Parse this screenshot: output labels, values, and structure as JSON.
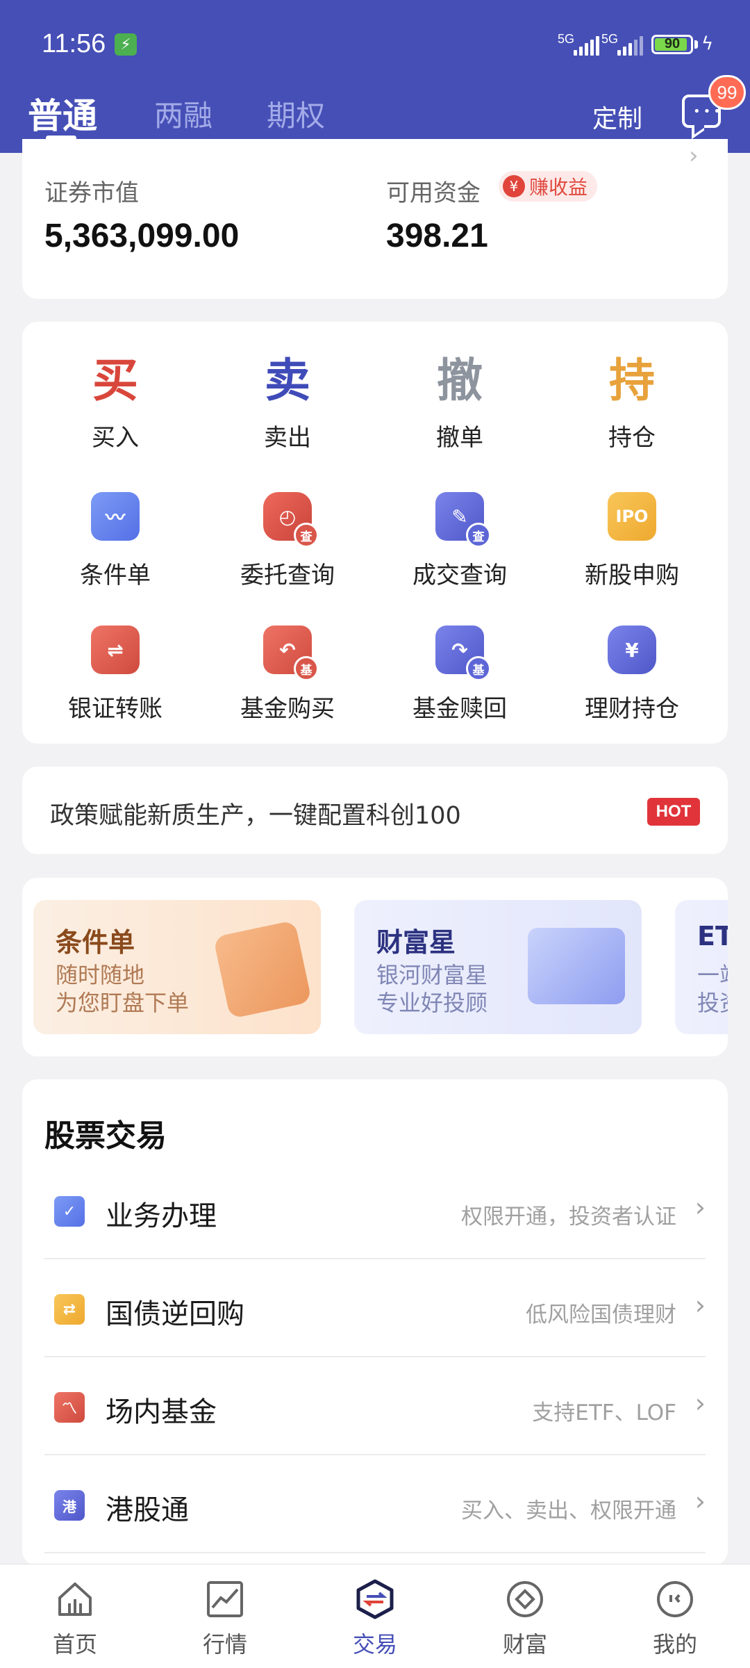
{
  "status_bar": {
    "time": "11:56",
    "network1": "5G",
    "network2": "5G",
    "battery": "90"
  },
  "header": {
    "tabs": [
      {
        "label": "普通",
        "active": true
      },
      {
        "label": "两融",
        "active": false
      },
      {
        "label": "期权",
        "active": false
      }
    ],
    "custom_label": "定制",
    "message_badge": "99"
  },
  "assets": {
    "securities_label": "证券市值",
    "securities_value": "5,363,099.00",
    "available_label": "可用资金",
    "available_value": "398.21",
    "earn_tag": "赚收益",
    "earn_icon": "¥"
  },
  "quick_actions": {
    "primary": [
      {
        "char": "买",
        "label": "买入",
        "color": "#d9463b"
      },
      {
        "char": "卖",
        "label": "卖出",
        "color": "#3f4bb8"
      },
      {
        "char": "撤",
        "label": "撤单",
        "color": "#8e949e"
      },
      {
        "char": "持",
        "label": "持仓",
        "color": "#e8a23c"
      }
    ],
    "secondary": [
      {
        "label": "条件单",
        "icon": "condition-order-icon"
      },
      {
        "label": "委托查询",
        "icon": "order-query-icon",
        "sub": "查"
      },
      {
        "label": "成交查询",
        "icon": "deal-query-icon",
        "sub": "查"
      },
      {
        "label": "新股申购",
        "icon": "ipo-icon",
        "text": "IPO"
      },
      {
        "label": "银证转账",
        "icon": "bank-transfer-icon"
      },
      {
        "label": "基金购买",
        "icon": "fund-buy-icon",
        "sub": "基"
      },
      {
        "label": "基金赎回",
        "icon": "fund-redeem-icon",
        "sub": "基"
      },
      {
        "label": "理财持仓",
        "icon": "wealth-position-icon",
        "text": "¥"
      }
    ]
  },
  "notice": {
    "text": "政策赋能新质生产，一键配置科创100",
    "tag": "HOT"
  },
  "banners": [
    {
      "title": "条件单",
      "sub1": "随时随地",
      "sub2": "为您盯盘下单"
    },
    {
      "title": "财富星",
      "sub1": "银河财富星",
      "sub2": "专业好投顾"
    },
    {
      "title": "ETI",
      "sub1": "一站",
      "sub2": "投资"
    }
  ],
  "stock_trading": {
    "title": "股票交易",
    "rows": [
      {
        "label": "业务办理",
        "desc": "权限开通，投资者认证",
        "icon": "business-check-icon"
      },
      {
        "label": "国债逆回购",
        "desc": "低风险国债理财",
        "icon": "repo-icon"
      },
      {
        "label": "场内基金",
        "desc": "支持ETF、LOF",
        "icon": "exchange-fund-icon"
      },
      {
        "label": "港股通",
        "desc": "买入、卖出、权限开通",
        "icon": "hk-connect-icon",
        "icon_text": "港"
      }
    ]
  },
  "bottom_nav": [
    {
      "label": "首页",
      "icon": "home-icon"
    },
    {
      "label": "行情",
      "icon": "market-chart-icon"
    },
    {
      "label": "交易",
      "icon": "trade-icon",
      "active": true
    },
    {
      "label": "财富",
      "icon": "wealth-icon"
    },
    {
      "label": "我的",
      "icon": "profile-icon"
    }
  ],
  "colors": {
    "brand": "#454fb6",
    "red": "#d9463b",
    "orange": "#e8a23c"
  }
}
